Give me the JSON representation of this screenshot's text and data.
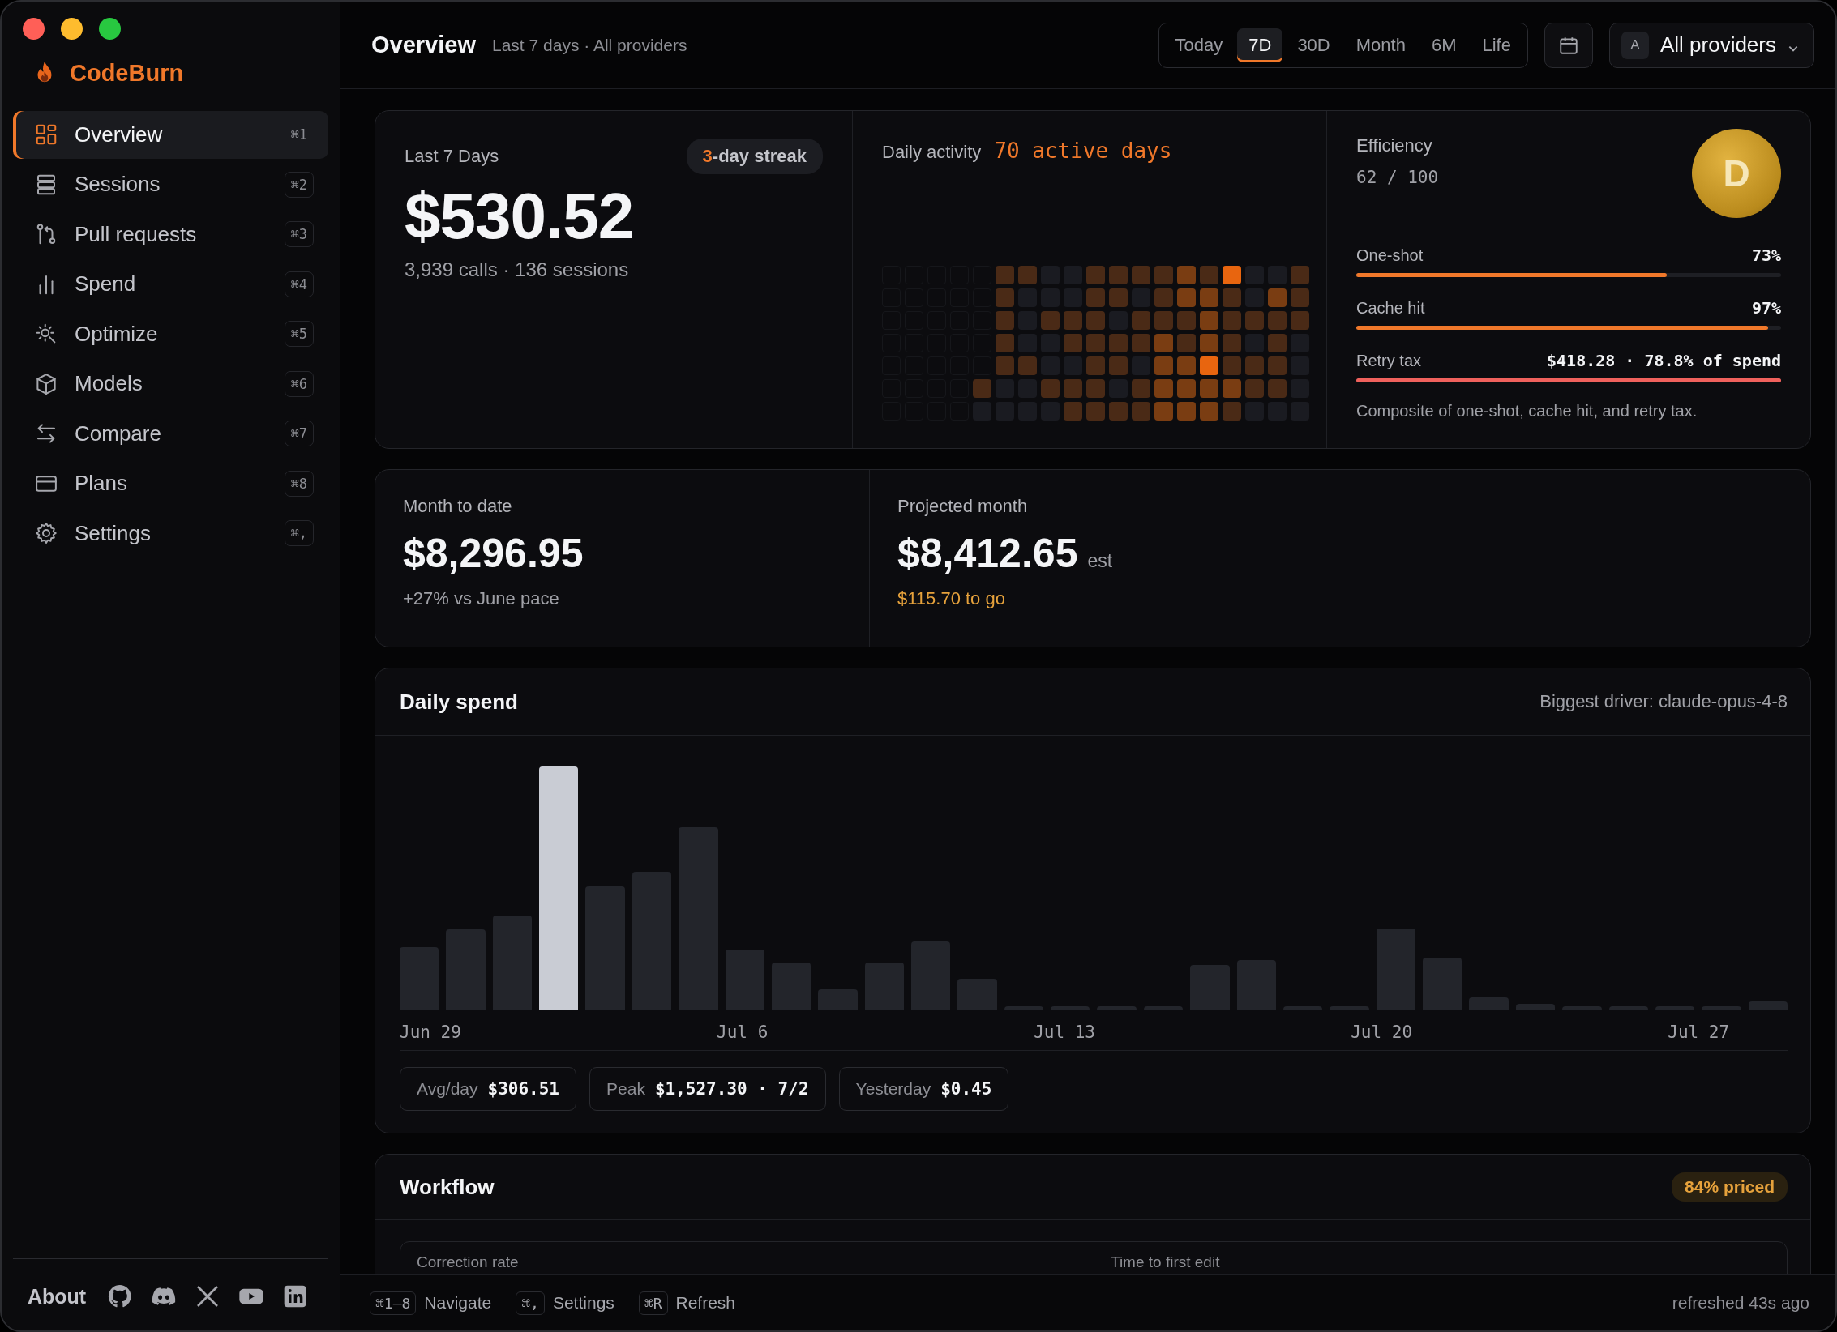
{
  "app": {
    "name": "CodeBurn"
  },
  "nav": [
    {
      "label": "Overview",
      "shortcut": "⌘1",
      "selected": true
    },
    {
      "label": "Sessions",
      "shortcut": "⌘2",
      "selected": false
    },
    {
      "label": "Pull requests",
      "shortcut": "⌘3",
      "selected": false
    },
    {
      "label": "Spend",
      "shortcut": "⌘4",
      "selected": false
    },
    {
      "label": "Optimize",
      "shortcut": "⌘5",
      "selected": false
    },
    {
      "label": "Models",
      "shortcut": "⌘6",
      "selected": false
    },
    {
      "label": "Compare",
      "shortcut": "⌘7",
      "selected": false
    },
    {
      "label": "Plans",
      "shortcut": "⌘8",
      "selected": false
    },
    {
      "label": "Settings",
      "shortcut": "⌘,",
      "selected": false
    }
  ],
  "about": {
    "label": "About"
  },
  "header": {
    "title": "Overview",
    "subtitle": "Last 7 days · All providers",
    "ranges": [
      {
        "label": "Today",
        "selected": false
      },
      {
        "label": "7D",
        "selected": true
      },
      {
        "label": "30D",
        "selected": false
      },
      {
        "label": "Month",
        "selected": false
      },
      {
        "label": "6M",
        "selected": false
      },
      {
        "label": "Life",
        "selected": false
      }
    ],
    "provider": {
      "avatar": "A",
      "label": "All providers"
    }
  },
  "summary": {
    "label": "Last 7 Days",
    "streak": {
      "count": "3",
      "text": "-day streak"
    },
    "amount": "$530.52",
    "detail": "3,939 calls · 136 sessions"
  },
  "activity": {
    "label": "Daily activity",
    "highlight": "70 active days"
  },
  "efficiency": {
    "label": "Efficiency",
    "score": "62 / 100",
    "grade": "D",
    "metrics": [
      {
        "name": "One-shot",
        "value": "73%",
        "level": 0.73,
        "kind": "good"
      },
      {
        "name": "Cache hit",
        "value": "97%",
        "level": 0.97,
        "kind": "good"
      },
      {
        "name": "Retry tax",
        "value": "$418.28 · 78.8% of spend",
        "level": 1,
        "kind": "bad"
      }
    ],
    "note": "Composite of one-shot, cache hit, and retry tax."
  },
  "month": {
    "label": "Month to date",
    "amount": "$8,296.95",
    "detail": "+27% vs June pace"
  },
  "projected": {
    "label": "Projected month",
    "amount": "$8,412.65",
    "suffix": "est",
    "detail": "$115.70 to go"
  },
  "daily_spend": {
    "title": "Daily spend",
    "driver": "Biggest driver: claude-opus-4-8",
    "x_labels": [
      "Jun 29",
      "Jul 6",
      "Jul 13",
      "Jul 20",
      "Jul 27"
    ],
    "stats": [
      {
        "label": "Avg/day",
        "value": "$306.51"
      },
      {
        "label": "Peak",
        "value": "$1,527.30 · 7/2"
      },
      {
        "label": "Yesterday",
        "value": "$0.45"
      }
    ]
  },
  "workflow": {
    "title": "Workflow",
    "badge": "84% priced",
    "metrics": [
      "Correction rate",
      "Time to first edit"
    ]
  },
  "footer": {
    "shortcuts": [
      {
        "key": "⌘1–8",
        "label": "Navigate"
      },
      {
        "key": "⌘,",
        "label": "Settings"
      },
      {
        "key": "⌘R",
        "label": "Refresh"
      }
    ],
    "status": "refreshed 43s ago"
  }
}
